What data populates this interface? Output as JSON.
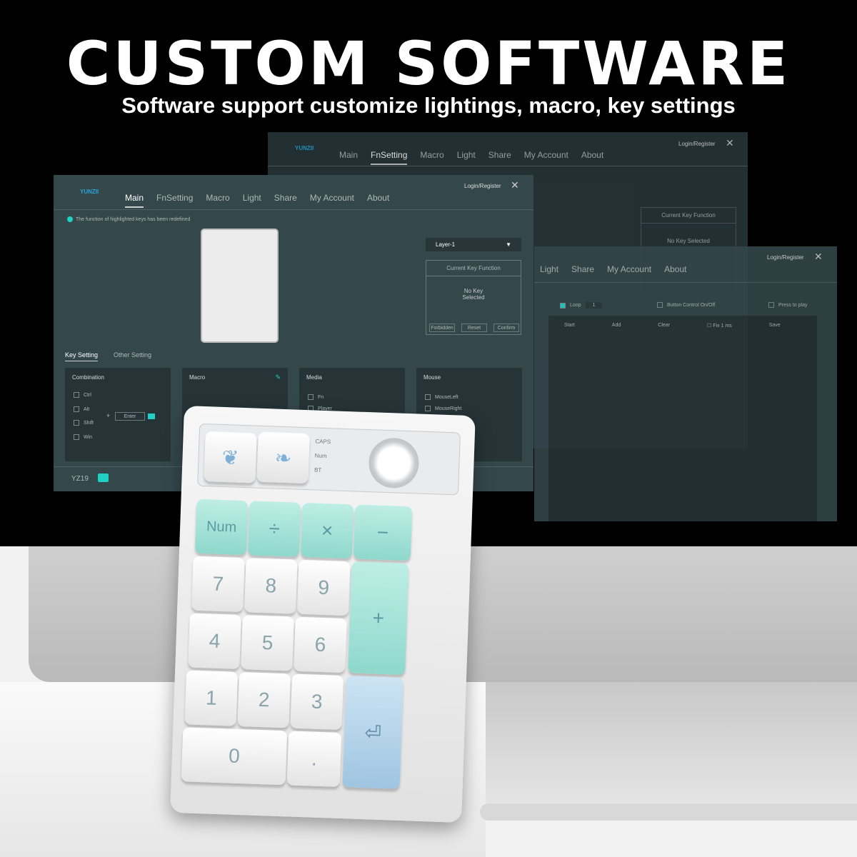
{
  "headline": "CUSTOM SOFTWARE",
  "subheadline": "Software support customize lightings, macro, key settings",
  "app": {
    "brand": "YUNZII",
    "tabs": [
      "Main",
      "FnSetting",
      "Macro",
      "Light",
      "Share",
      "My Account",
      "About"
    ],
    "login": "Login/Register",
    "notice": "The function of highlighted keys has been redefined",
    "accent": "#1fd1c5",
    "layer_select": "Layer-1",
    "current_key": {
      "title": "Current Key Function",
      "status": "No Key Selected",
      "buttons": [
        "Forbidden",
        "Reset",
        "Confirm"
      ]
    },
    "subtabs": [
      "Key Setting",
      "Other Setting"
    ],
    "panels": {
      "combination": {
        "title": "Combination",
        "items": [
          "Ctrl",
          "Alt",
          "Shift",
          "Win"
        ],
        "plus": "+",
        "key": "Enter"
      },
      "macro": {
        "title": "Macro"
      },
      "media": {
        "title": "Media",
        "items": [
          "Fn",
          "Player"
        ]
      },
      "mouse": {
        "title": "Mouse",
        "items": [
          "MouseLeft",
          "MouseRight"
        ]
      }
    },
    "device": "YZ19"
  },
  "back_window": {
    "brand": "YUNZII",
    "tabs": [
      "Main",
      "FnSetting",
      "Macro",
      "Light",
      "Share",
      "My Account",
      "About"
    ],
    "login": "Login/Register",
    "current_key": "Current Key Function",
    "status": "No Key Selected"
  },
  "macro_window": {
    "tabs": [
      "Light",
      "Share",
      "My Account",
      "About"
    ],
    "login": "Login/Register",
    "loop": "Loop",
    "loop_count": "1",
    "button_control": "Button Control On/Off",
    "press_to_play": "Press to play",
    "toolbar": [
      "Start",
      "Add",
      "Clear"
    ],
    "fix": "Fix",
    "fix_value": "1",
    "unit": "ms",
    "save": "Save"
  },
  "keypad": {
    "rows": [
      [
        "Num",
        "÷",
        "×",
        "−"
      ],
      [
        "7",
        "8",
        "9",
        "+"
      ],
      [
        "4",
        "5",
        "6"
      ],
      [
        "1",
        "2",
        "3",
        "⏎"
      ],
      [
        "0",
        "."
      ]
    ],
    "leds": [
      "CAPS",
      "Num",
      "BT"
    ]
  }
}
